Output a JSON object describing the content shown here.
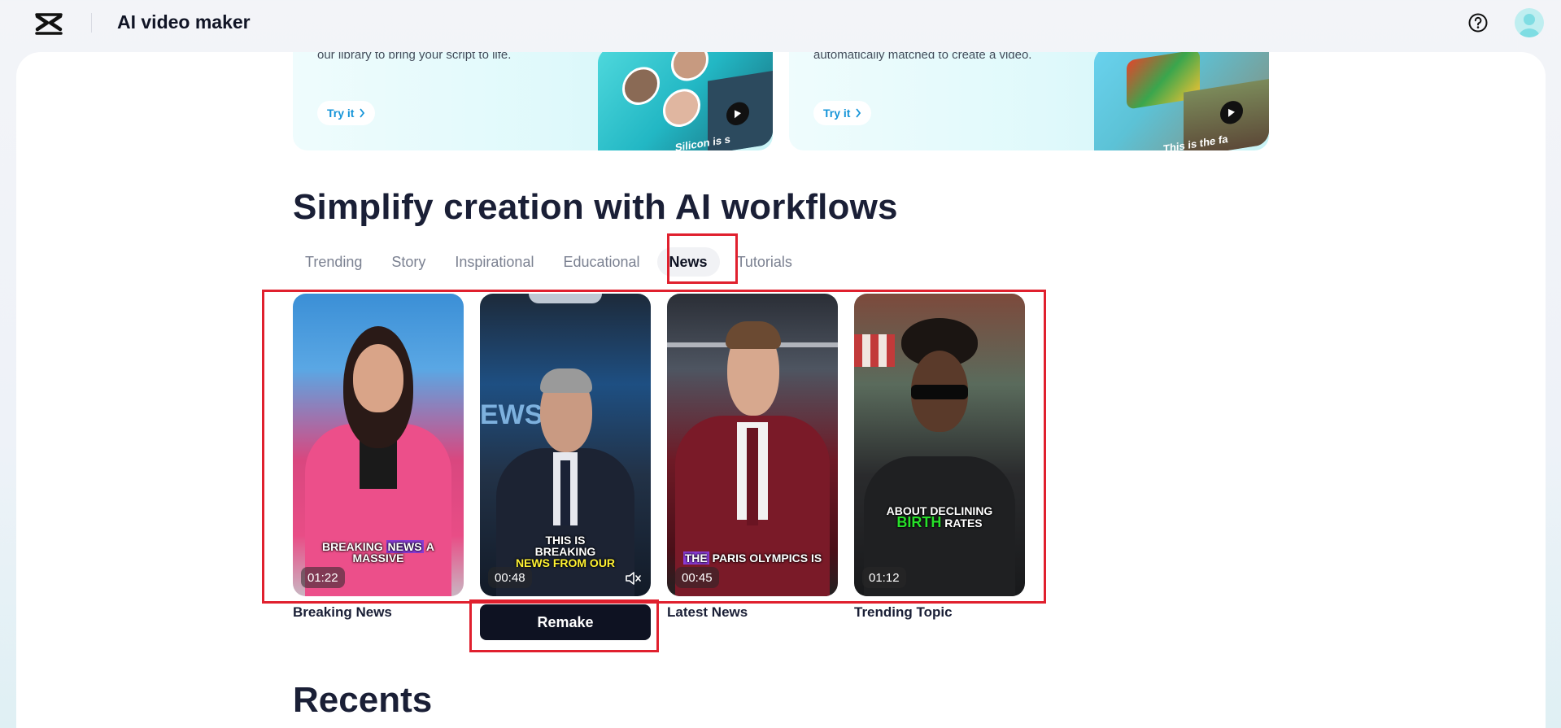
{
  "app": {
    "title": "AI video maker"
  },
  "feature_cards": [
    {
      "description": "our library to bring your script to life.",
      "button_label": "Try it",
      "art_caption": "Silicon is s"
    },
    {
      "description": "automatically matched to create a video.",
      "button_label": "Try it",
      "art_caption": "This is the fa"
    }
  ],
  "section": {
    "title": "Simplify creation with AI workflows",
    "tabs": [
      {
        "label": "Trending"
      },
      {
        "label": "Story"
      },
      {
        "label": "Inspirational"
      },
      {
        "label": "Educational"
      },
      {
        "label": "News",
        "active": true
      },
      {
        "label": "Tutorials"
      }
    ]
  },
  "videos": [
    {
      "title": "Breaking News",
      "duration": "01:22",
      "caption_parts": [
        "BREAKING ",
        "NEWS",
        " A",
        "MASSIVE"
      ]
    },
    {
      "title": "",
      "duration": "00:48",
      "caption_parts": [
        "THIS IS",
        "BREAKING",
        "NEWS FROM OUR"
      ],
      "action_label": "Remake"
    },
    {
      "title": "Latest News",
      "duration": "00:45",
      "caption_parts": [
        "THE",
        " PARIS OLYMPICS IS"
      ]
    },
    {
      "title": "Trending Topic",
      "duration": "01:12",
      "caption_parts": [
        "ABOUT DECLINING",
        "BIRTH",
        " RATES"
      ]
    }
  ],
  "recents": {
    "title": "Recents"
  },
  "colors": {
    "accent_blue": "#1494d8",
    "highlight_red": "#e0202e",
    "dark": "#0e1222"
  },
  "icons": [
    "capcut-logo-icon",
    "help-icon",
    "avatar",
    "chevron-right-icon",
    "play-icon",
    "mute-icon"
  ]
}
